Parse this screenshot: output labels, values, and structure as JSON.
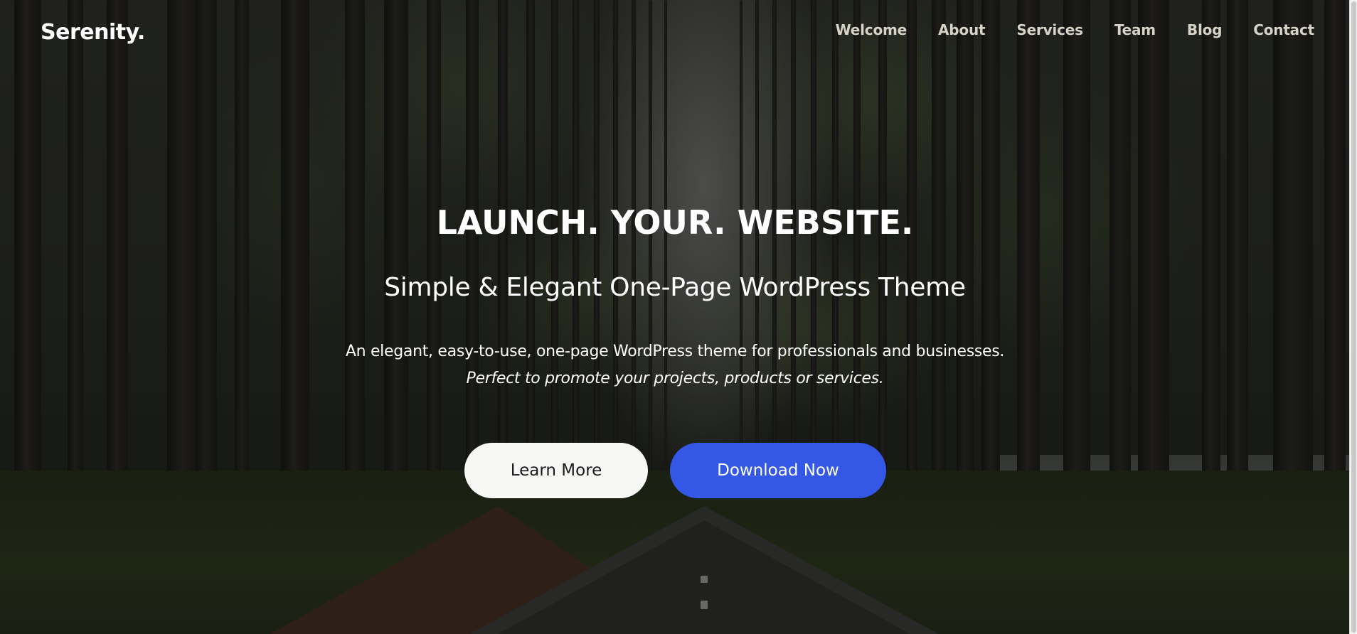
{
  "header": {
    "logo": "Serenity.",
    "nav": [
      "Welcome",
      "About",
      "Services",
      "Team",
      "Blog",
      "Contact"
    ]
  },
  "hero": {
    "headline": "LAUNCH. YOUR. WEBSITE.",
    "subheadline": "Simple & Elegant One-Page WordPress Theme",
    "description": "An elegant, easy-to-use, one-page WordPress theme for professionals and businesses.",
    "description_italic": "Perfect to promote your projects, products or services.",
    "buttons": {
      "learn_more": "Learn More",
      "download_now": "Download Now"
    }
  },
  "colors": {
    "primary_button": "#3457e6",
    "secondary_button": "#f7f7f5",
    "nav_text": "#d7d3c9"
  }
}
